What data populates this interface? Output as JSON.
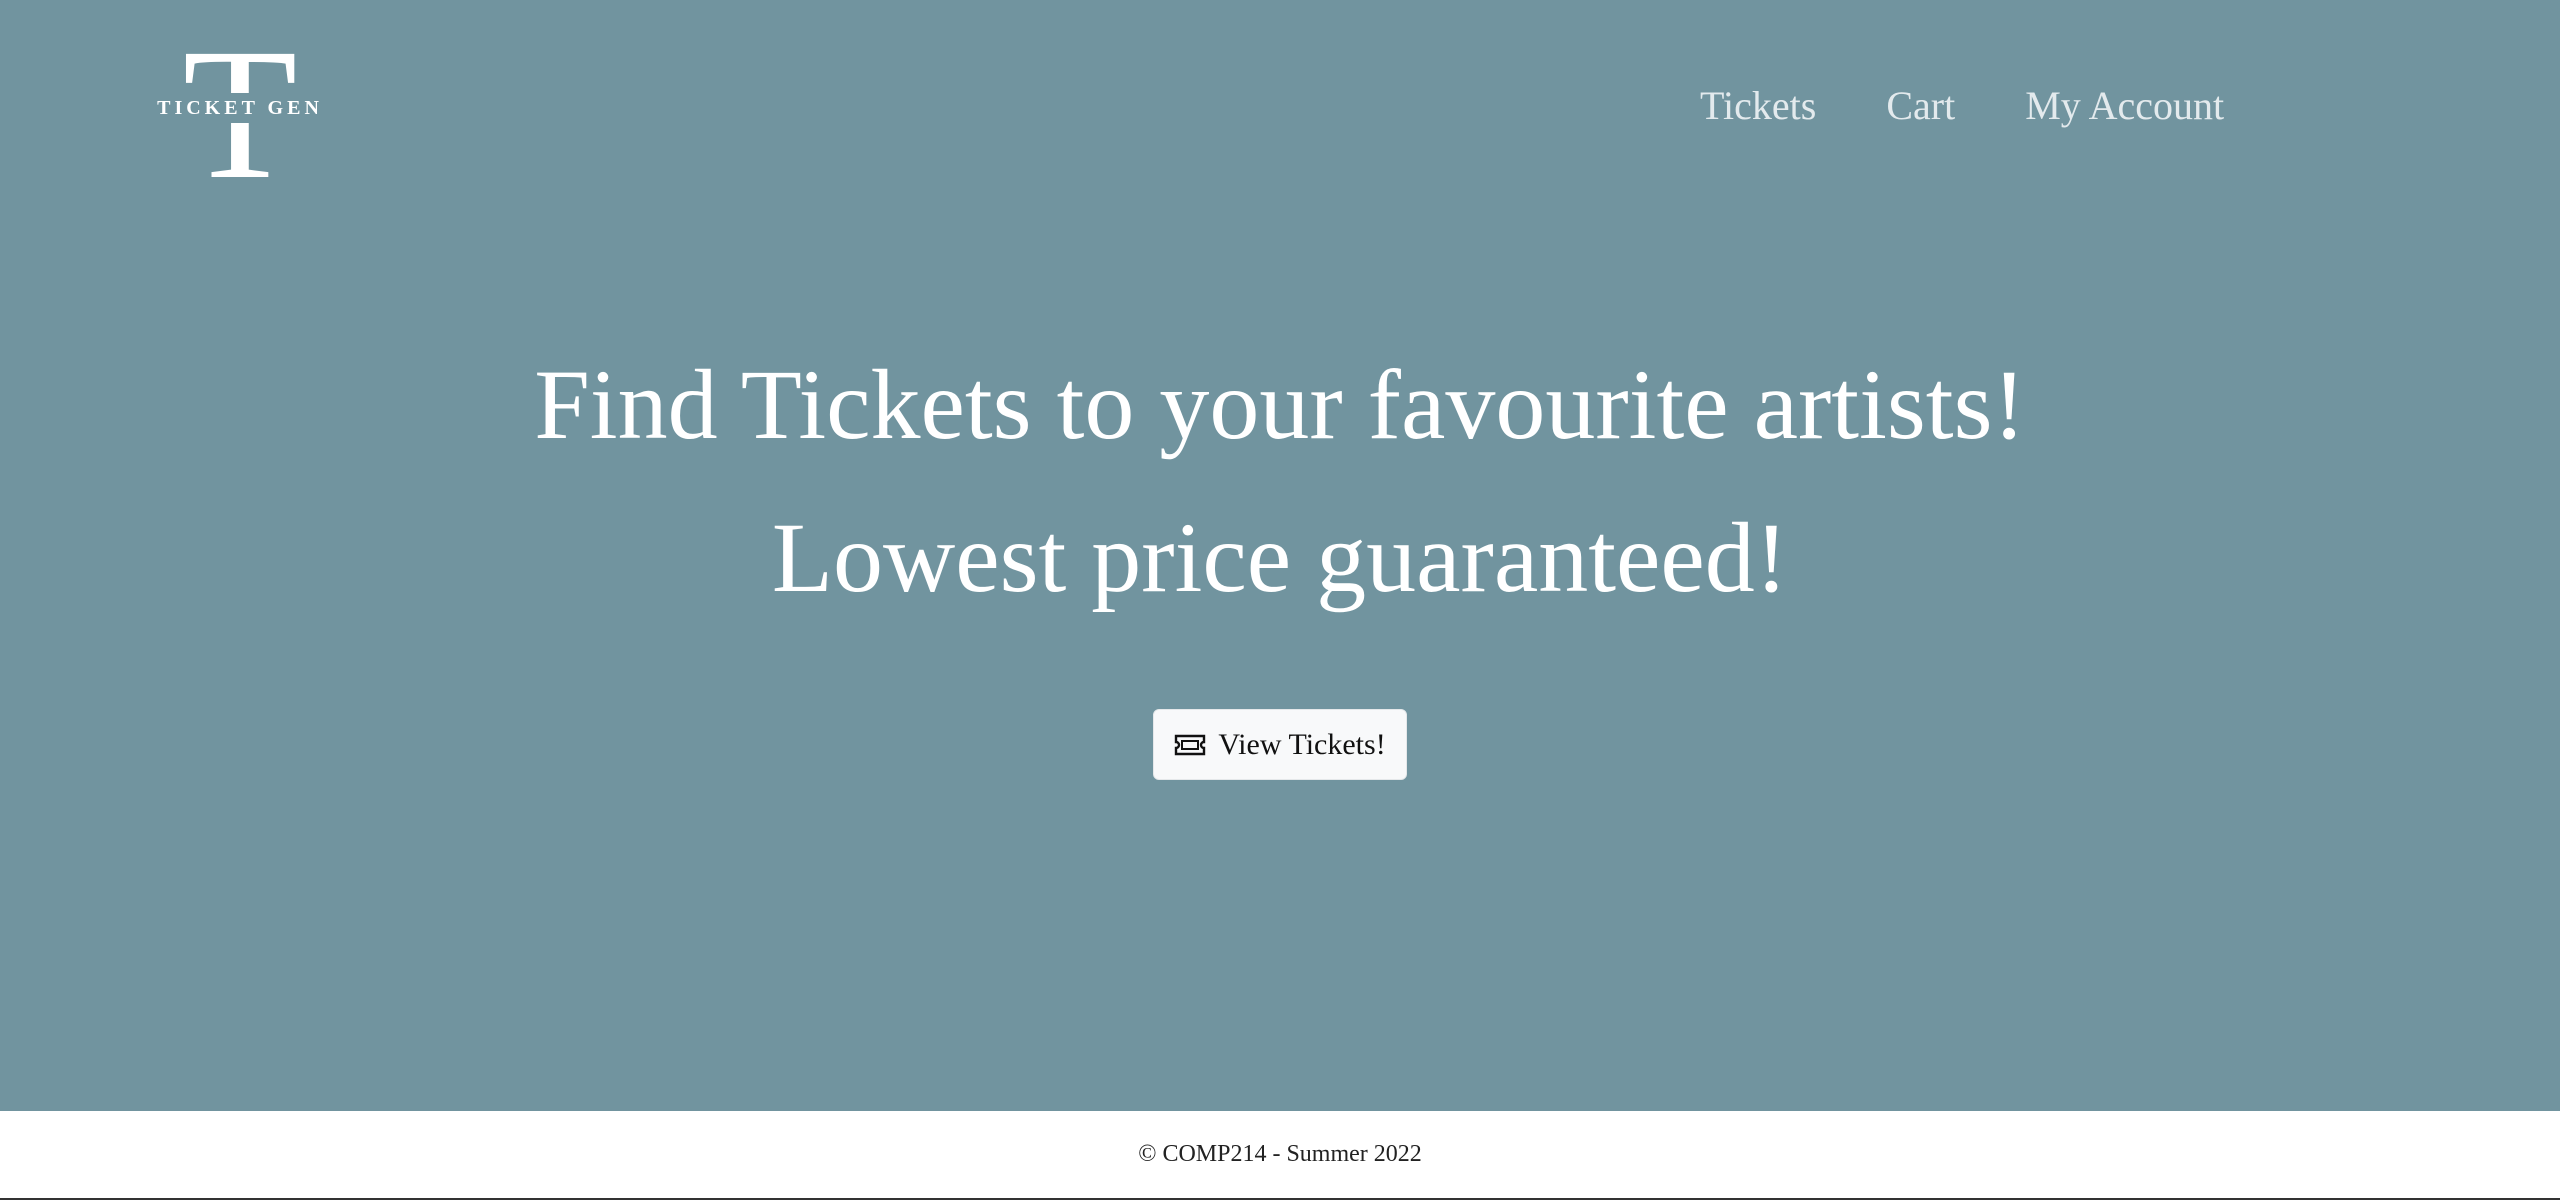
{
  "brand": {
    "logo_letter": "T",
    "logo_text": "TICKET GEN"
  },
  "nav": {
    "items": [
      {
        "label": "Tickets"
      },
      {
        "label": "Cart"
      },
      {
        "label": "My Account"
      }
    ]
  },
  "hero": {
    "headline_line1": "Find Tickets to your favourite artists!",
    "headline_line2": "Lowest price guaranteed!",
    "cta_label": "View Tickets!",
    "cta_icon": "ticket-icon"
  },
  "footer": {
    "text": "© COMP214 - Summer 2022"
  },
  "colors": {
    "hero_background": "#71949f",
    "nav_text": "#e3eaed",
    "headline_text": "#ffffff",
    "button_background": "#f8f9fa",
    "footer_background": "#ffffff"
  }
}
